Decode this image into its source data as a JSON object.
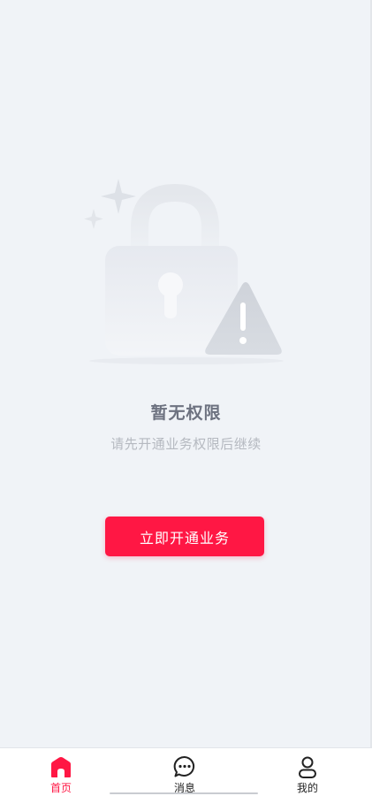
{
  "empty_state": {
    "title": "暂无权限",
    "subtitle": "请先开通业务权限后继续",
    "illustration_icon": "lock-warning-icon"
  },
  "cta": {
    "label": "立即开通业务"
  },
  "tabbar": {
    "items": [
      {
        "label": "首页",
        "icon": "home-icon",
        "active": true
      },
      {
        "label": "消息",
        "icon": "message-icon",
        "active": false
      },
      {
        "label": "我的",
        "icon": "profile-icon",
        "active": false
      }
    ]
  },
  "colors": {
    "accent": "#ff1744",
    "background": "#f0f3f7",
    "title": "#6d7280",
    "subtitle": "#b5b9c0"
  }
}
